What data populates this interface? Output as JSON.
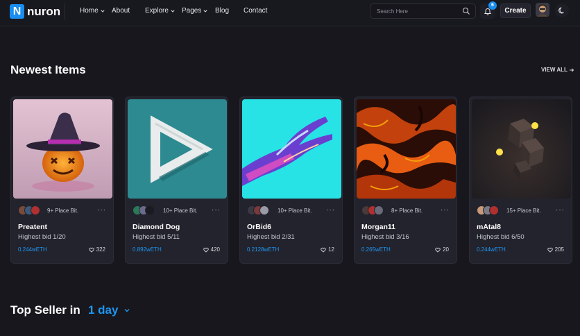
{
  "header": {
    "logo_mark": "N",
    "logo_text": "nuron",
    "nav": [
      {
        "label": "Home",
        "has_dropdown": true
      },
      {
        "label": "About",
        "has_dropdown": false
      },
      {
        "label": "Explore",
        "has_dropdown": true
      },
      {
        "label": "Pages",
        "has_dropdown": true
      },
      {
        "label": "Blog",
        "has_dropdown": false
      },
      {
        "label": "Contact",
        "has_dropdown": false
      }
    ],
    "search_placeholder": "Search Here",
    "notification_count": "6",
    "create_label": "Create"
  },
  "newest": {
    "title": "Newest Items",
    "view_all": "VIEW ALL"
  },
  "items": [
    {
      "bids": "9+ Place Bit.",
      "name": "Preatent",
      "highest": "Highest bid 1/20",
      "price": "0.244wETH",
      "likes": "322",
      "more": "···"
    },
    {
      "bids": "10+ Place Bit.",
      "name": "Diamond Dog",
      "highest": "Highest bid 5/11",
      "price": "0.892wETH",
      "likes": "420",
      "more": "···"
    },
    {
      "bids": "10+ Place Bit.",
      "name": "OrBid6",
      "highest": "Highest bid 2/31",
      "price": "0.2128wETH",
      "likes": "12",
      "more": "···"
    },
    {
      "bids": "8+ Place Bit.",
      "name": "Morgan11",
      "highest": "Highest bid 3/16",
      "price": "0.265wETH",
      "likes": "20",
      "more": "···"
    },
    {
      "bids": "15+ Place Bit.",
      "name": "mAtal8",
      "highest": "Highest bid 6/50",
      "price": "0.244wETH",
      "likes": "205",
      "more": "···"
    }
  ],
  "top_seller": {
    "title": "Top Seller in",
    "period": "1 day"
  },
  "colors": {
    "accent": "#1e97f3",
    "background": "#17171d",
    "card": "#23232d"
  }
}
